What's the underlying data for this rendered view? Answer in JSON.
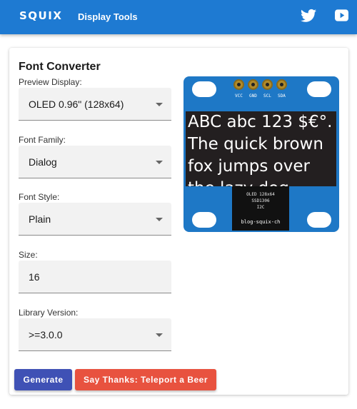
{
  "header": {
    "logo": "SQUIX",
    "title": "Display Tools",
    "social_icons": [
      "twitter-icon",
      "youtube-icon"
    ]
  },
  "card": {
    "title": "Font Converter"
  },
  "form": {
    "preview_display": {
      "label": "Preview Display:",
      "value": "OLED 0.96\" (128x64)"
    },
    "font_family": {
      "label": "Font Family:",
      "value": "Dialog"
    },
    "font_style": {
      "label": "Font Style:",
      "value": "Plain"
    },
    "size": {
      "label": "Size:",
      "value": "16"
    },
    "library_version": {
      "label": "Library Version:",
      "value": ">=3.0.0"
    }
  },
  "buttons": {
    "generate": "Generate",
    "thanks": "Say Thanks: Teleport a Beer"
  },
  "preview": {
    "pins": [
      "VCC",
      "GND",
      "SCL",
      "SDA"
    ],
    "text": "ABC abc 123 $€°. The quick brown fox jumps over the lazy dog",
    "chip_lines": [
      "OLED 128x64",
      "SSD1306",
      "I2C"
    ],
    "chip_url": "blog-squix-ch"
  },
  "colors": {
    "appbar": "#1e7ad2",
    "generate_button": "#3f51b5",
    "thanks_button": "#e8523f",
    "board": "#1e78c6"
  }
}
